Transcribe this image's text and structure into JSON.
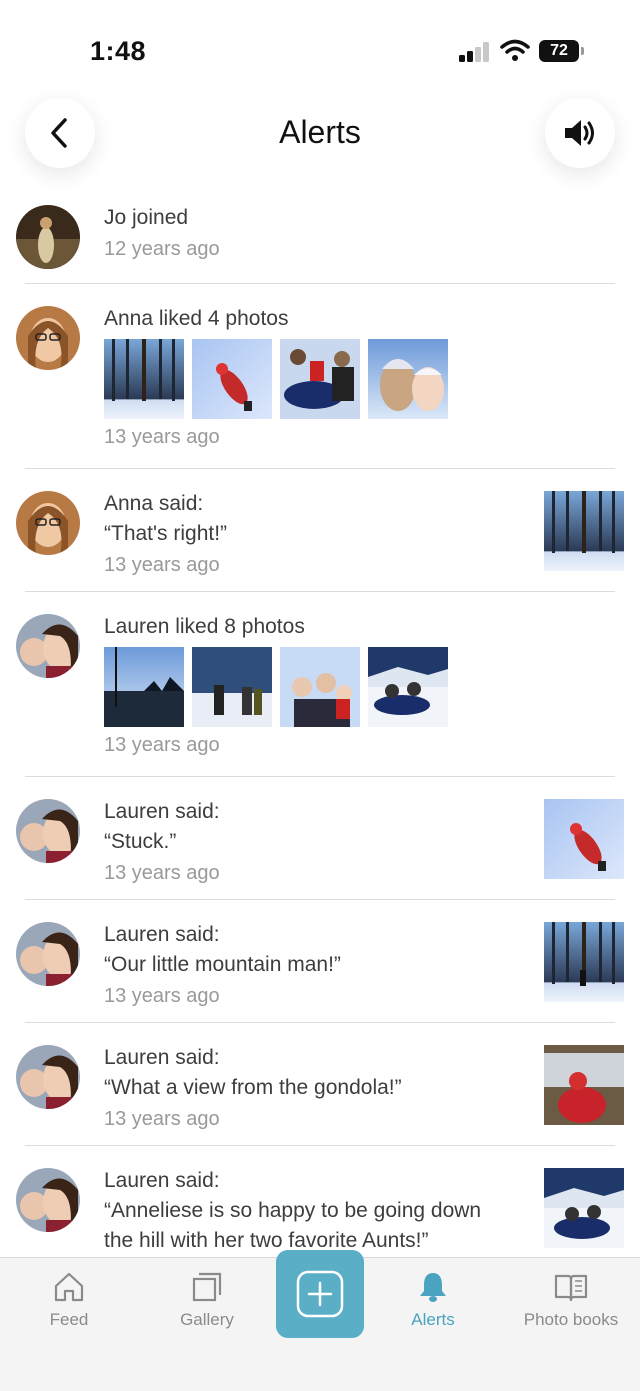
{
  "status_bar": {
    "time": "1:48",
    "battery": "72"
  },
  "header": {
    "title": "Alerts"
  },
  "alerts": [
    {
      "text": "Jo joined",
      "time": "12 years ago"
    },
    {
      "text": "Anna liked 4 photos",
      "time": "13 years ago"
    },
    {
      "text": "Anna said:",
      "quote": "“That's right!”",
      "time": "13 years ago"
    },
    {
      "text": "Lauren liked 8 photos",
      "time": "13 years ago"
    },
    {
      "text": "Lauren said:",
      "quote": "“Stuck.”",
      "time": "13 years ago"
    },
    {
      "text": "Lauren said:",
      "quote": "“Our little mountain man!”",
      "time": "13 years ago"
    },
    {
      "text": "Lauren said:",
      "quote": "“What a view from the gondola!”",
      "time": "13 years ago"
    },
    {
      "text": "Lauren said:",
      "quote_line1": "“Anneliese is so happy to be going down",
      "quote_line2": "the hill with her two favorite Aunts!”"
    }
  ],
  "tabs": [
    {
      "label": "Feed",
      "icon": "home-icon"
    },
    {
      "label": "Gallery",
      "icon": "gallery-icon"
    },
    {
      "label": "Alerts",
      "icon": "bell-icon",
      "active": true
    },
    {
      "label": "Photo books",
      "icon": "book-icon"
    }
  ],
  "add_button": {
    "icon": "plus-icon"
  },
  "colors": {
    "accent": "#5aaec6",
    "active_tab": "#4aa3c0",
    "secondary_text": "#999999"
  }
}
